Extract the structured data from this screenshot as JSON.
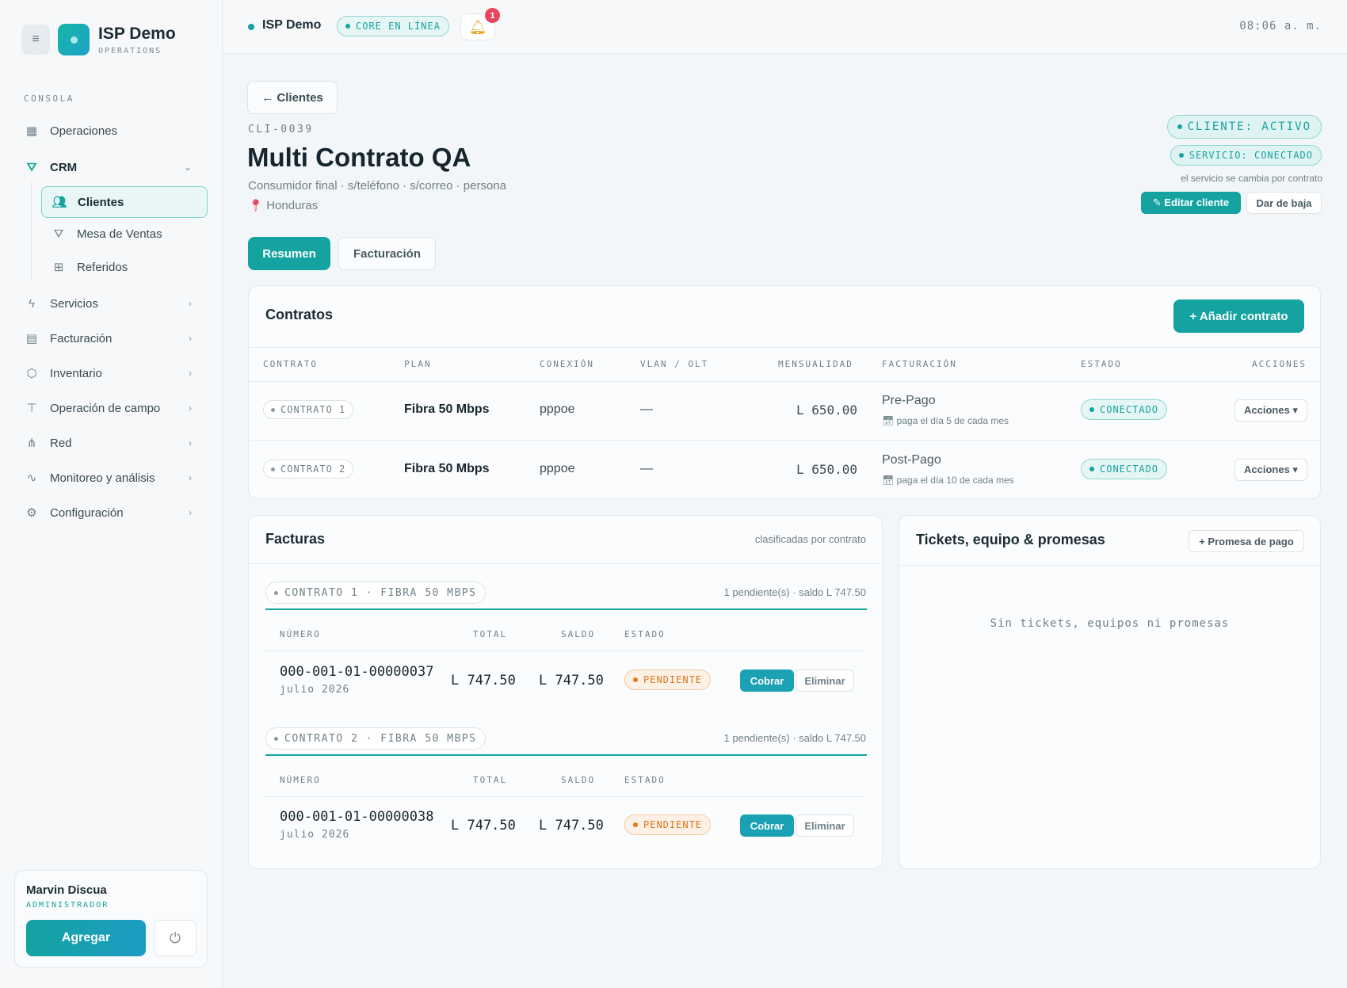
{
  "brand": {
    "name": "ISP Demo",
    "subtitle": "OPERATIONS"
  },
  "sidebar": {
    "section": "CONSOLA",
    "items": [
      {
        "label": "Operaciones"
      },
      {
        "label": "CRM"
      },
      {
        "label": "Servicios"
      },
      {
        "label": "Facturación"
      },
      {
        "label": "Inventario"
      },
      {
        "label": "Operación de campo"
      },
      {
        "label": "Red"
      },
      {
        "label": "Monitoreo y análisis"
      },
      {
        "label": "Configuración"
      }
    ],
    "crm_sub": [
      {
        "label": "Clientes"
      },
      {
        "label": "Mesa de Ventas"
      },
      {
        "label": "Referidos"
      }
    ]
  },
  "user": {
    "name": "Marvin Discua",
    "role": "ADMINISTRADOR",
    "add_label": "Agregar",
    "power_icon": "⏻"
  },
  "topbar": {
    "name": "ISP Demo",
    "core_status": "CORE EN LÍNEA",
    "notifications": "1",
    "time": "08:06 a. m."
  },
  "client": {
    "back_label": "← Clientes",
    "id": "CLI-0039",
    "name": "Multi Contrato QA",
    "meta": "Consumidor final · s/teléfono · s/correo · persona",
    "location": "Honduras",
    "status_client": "CLIENTE: ACTIVO",
    "status_service": "SERVICIO: CONECTADO",
    "service_note": "el servicio se cambia por contrato",
    "edit_label": "✎ Editar cliente",
    "baja_label": "Dar de baja"
  },
  "tabs": [
    {
      "label": "Resumen"
    },
    {
      "label": "Facturación"
    }
  ],
  "contracts": {
    "title": "Contratos",
    "add_label": "+ Añadir contrato",
    "headers": [
      "CONTRATO",
      "PLAN",
      "CONEXIÓN",
      "VLAN / OLT",
      "MENSUALIDAD",
      "FACTURACIÓN",
      "ESTADO",
      "ACCIONES"
    ],
    "rows": [
      {
        "contract": "CONTRATO 1",
        "plan": "Fibra 50 Mbps",
        "connection": "pppoe",
        "vlan": "—",
        "monthly": "L 650.00",
        "billing": "Pre-Pago",
        "billing_day": "paga el día 5 de cada mes",
        "status": "CONECTADO",
        "actions": "Acciones ▾"
      },
      {
        "contract": "CONTRATO 2",
        "plan": "Fibra 50 Mbps",
        "connection": "pppoe",
        "vlan": "—",
        "monthly": "L 650.00",
        "billing": "Post-Pago",
        "billing_day": "paga el día 10 de cada mes",
        "status": "CONECTADO",
        "actions": "Acciones ▾"
      }
    ]
  },
  "invoices": {
    "title": "Facturas",
    "subtitle": "clasificadas por contrato",
    "headers": [
      "NÚMERO",
      "TOTAL",
      "SALDO",
      "ESTADO"
    ],
    "groups": [
      {
        "label": "CONTRATO 1 · FIBRA 50 MBPS",
        "note": "1 pendiente(s) · saldo L 747.50",
        "invoice": {
          "number": "000-001-01-00000037",
          "date": "julio 2026",
          "total": "L 747.50",
          "balance": "L 747.50",
          "status": "PENDIENTE",
          "charge": "Cobrar",
          "delete": "Eliminar"
        }
      },
      {
        "label": "CONTRATO 2 · FIBRA 50 MBPS",
        "note": "1 pendiente(s) · saldo L 747.50",
        "invoice": {
          "number": "000-001-01-00000038",
          "date": "julio 2026",
          "total": "L 747.50",
          "balance": "L 747.50",
          "status": "PENDIENTE",
          "charge": "Cobrar",
          "delete": "Eliminar"
        }
      }
    ]
  },
  "tickets": {
    "title": "Tickets, equipo & promesas",
    "promise_label": "+ Promesa de pago",
    "empty": "Sin tickets, equipos ni promesas"
  },
  "colors": {
    "accent": "#14a3a0",
    "pending": "#d8761c",
    "alert": "#e9455e"
  }
}
